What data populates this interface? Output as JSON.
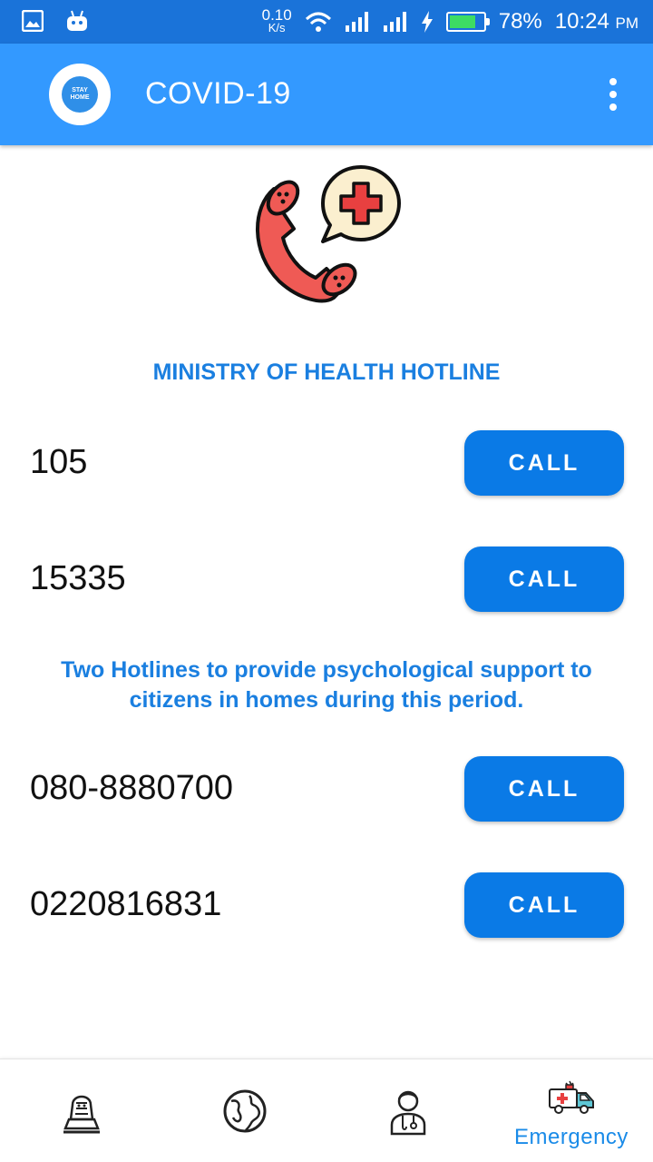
{
  "status_bar": {
    "net_speed_value": "0.10",
    "net_speed_unit": "K/s",
    "battery_percent": "78%",
    "time": "10:24",
    "time_suffix": "PM",
    "battery_level": 0.78
  },
  "app_bar": {
    "title": "COVID-19",
    "logo_text": "STAY HOME"
  },
  "main": {
    "ministry_title": "MINISTRY OF HEALTH HOTLINE",
    "ministry_hotlines": [
      {
        "number": "105",
        "button": "CALL"
      },
      {
        "number": "15335",
        "button": "CALL"
      }
    ],
    "psych_title": "Two Hotlines to provide psychological support to citizens in homes during this period.",
    "psych_hotlines": [
      {
        "number": "080-8880700",
        "button": "CALL"
      },
      {
        "number": "0220816831",
        "button": "CALL"
      }
    ]
  },
  "bottom_nav": {
    "items": [
      {
        "icon": "sphinx-icon",
        "label": ""
      },
      {
        "icon": "globe-icon",
        "label": ""
      },
      {
        "icon": "doctor-icon",
        "label": ""
      },
      {
        "icon": "ambulance-icon",
        "label": "Emergency"
      }
    ]
  },
  "colors": {
    "status_bar": "#1a73d9",
    "app_bar": "#3399ff",
    "accent_text": "#1a7fe0",
    "button": "#0a7ae6"
  }
}
